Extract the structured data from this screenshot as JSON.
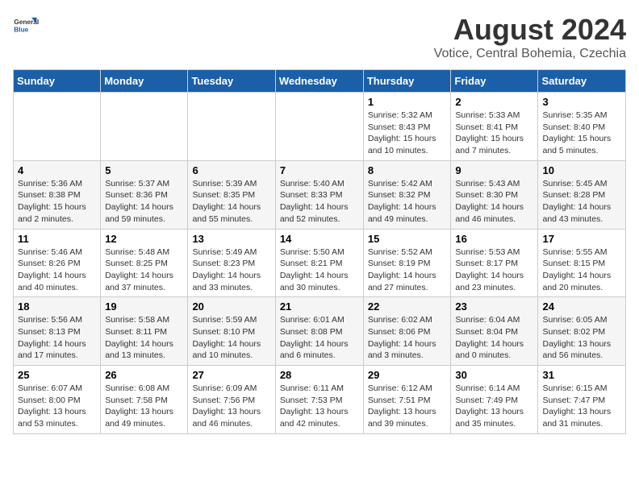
{
  "header": {
    "logo_line1": "General",
    "logo_line2": "Blue",
    "month_year": "August 2024",
    "location": "Votice, Central Bohemia, Czechia"
  },
  "days_of_week": [
    "Sunday",
    "Monday",
    "Tuesday",
    "Wednesday",
    "Thursday",
    "Friday",
    "Saturday"
  ],
  "weeks": [
    [
      {
        "day": "",
        "info": ""
      },
      {
        "day": "",
        "info": ""
      },
      {
        "day": "",
        "info": ""
      },
      {
        "day": "",
        "info": ""
      },
      {
        "day": "1",
        "info": "Sunrise: 5:32 AM\nSunset: 8:43 PM\nDaylight: 15 hours\nand 10 minutes."
      },
      {
        "day": "2",
        "info": "Sunrise: 5:33 AM\nSunset: 8:41 PM\nDaylight: 15 hours\nand 7 minutes."
      },
      {
        "day": "3",
        "info": "Sunrise: 5:35 AM\nSunset: 8:40 PM\nDaylight: 15 hours\nand 5 minutes."
      }
    ],
    [
      {
        "day": "4",
        "info": "Sunrise: 5:36 AM\nSunset: 8:38 PM\nDaylight: 15 hours\nand 2 minutes."
      },
      {
        "day": "5",
        "info": "Sunrise: 5:37 AM\nSunset: 8:36 PM\nDaylight: 14 hours\nand 59 minutes."
      },
      {
        "day": "6",
        "info": "Sunrise: 5:39 AM\nSunset: 8:35 PM\nDaylight: 14 hours\nand 55 minutes."
      },
      {
        "day": "7",
        "info": "Sunrise: 5:40 AM\nSunset: 8:33 PM\nDaylight: 14 hours\nand 52 minutes."
      },
      {
        "day": "8",
        "info": "Sunrise: 5:42 AM\nSunset: 8:32 PM\nDaylight: 14 hours\nand 49 minutes."
      },
      {
        "day": "9",
        "info": "Sunrise: 5:43 AM\nSunset: 8:30 PM\nDaylight: 14 hours\nand 46 minutes."
      },
      {
        "day": "10",
        "info": "Sunrise: 5:45 AM\nSunset: 8:28 PM\nDaylight: 14 hours\nand 43 minutes."
      }
    ],
    [
      {
        "day": "11",
        "info": "Sunrise: 5:46 AM\nSunset: 8:26 PM\nDaylight: 14 hours\nand 40 minutes."
      },
      {
        "day": "12",
        "info": "Sunrise: 5:48 AM\nSunset: 8:25 PM\nDaylight: 14 hours\nand 37 minutes."
      },
      {
        "day": "13",
        "info": "Sunrise: 5:49 AM\nSunset: 8:23 PM\nDaylight: 14 hours\nand 33 minutes."
      },
      {
        "day": "14",
        "info": "Sunrise: 5:50 AM\nSunset: 8:21 PM\nDaylight: 14 hours\nand 30 minutes."
      },
      {
        "day": "15",
        "info": "Sunrise: 5:52 AM\nSunset: 8:19 PM\nDaylight: 14 hours\nand 27 minutes."
      },
      {
        "day": "16",
        "info": "Sunrise: 5:53 AM\nSunset: 8:17 PM\nDaylight: 14 hours\nand 23 minutes."
      },
      {
        "day": "17",
        "info": "Sunrise: 5:55 AM\nSunset: 8:15 PM\nDaylight: 14 hours\nand 20 minutes."
      }
    ],
    [
      {
        "day": "18",
        "info": "Sunrise: 5:56 AM\nSunset: 8:13 PM\nDaylight: 14 hours\nand 17 minutes."
      },
      {
        "day": "19",
        "info": "Sunrise: 5:58 AM\nSunset: 8:11 PM\nDaylight: 14 hours\nand 13 minutes."
      },
      {
        "day": "20",
        "info": "Sunrise: 5:59 AM\nSunset: 8:10 PM\nDaylight: 14 hours\nand 10 minutes."
      },
      {
        "day": "21",
        "info": "Sunrise: 6:01 AM\nSunset: 8:08 PM\nDaylight: 14 hours\nand 6 minutes."
      },
      {
        "day": "22",
        "info": "Sunrise: 6:02 AM\nSunset: 8:06 PM\nDaylight: 14 hours\nand 3 minutes."
      },
      {
        "day": "23",
        "info": "Sunrise: 6:04 AM\nSunset: 8:04 PM\nDaylight: 14 hours\nand 0 minutes."
      },
      {
        "day": "24",
        "info": "Sunrise: 6:05 AM\nSunset: 8:02 PM\nDaylight: 13 hours\nand 56 minutes."
      }
    ],
    [
      {
        "day": "25",
        "info": "Sunrise: 6:07 AM\nSunset: 8:00 PM\nDaylight: 13 hours\nand 53 minutes."
      },
      {
        "day": "26",
        "info": "Sunrise: 6:08 AM\nSunset: 7:58 PM\nDaylight: 13 hours\nand 49 minutes."
      },
      {
        "day": "27",
        "info": "Sunrise: 6:09 AM\nSunset: 7:56 PM\nDaylight: 13 hours\nand 46 minutes."
      },
      {
        "day": "28",
        "info": "Sunrise: 6:11 AM\nSunset: 7:53 PM\nDaylight: 13 hours\nand 42 minutes."
      },
      {
        "day": "29",
        "info": "Sunrise: 6:12 AM\nSunset: 7:51 PM\nDaylight: 13 hours\nand 39 minutes."
      },
      {
        "day": "30",
        "info": "Sunrise: 6:14 AM\nSunset: 7:49 PM\nDaylight: 13 hours\nand 35 minutes."
      },
      {
        "day": "31",
        "info": "Sunrise: 6:15 AM\nSunset: 7:47 PM\nDaylight: 13 hours\nand 31 minutes."
      }
    ]
  ]
}
